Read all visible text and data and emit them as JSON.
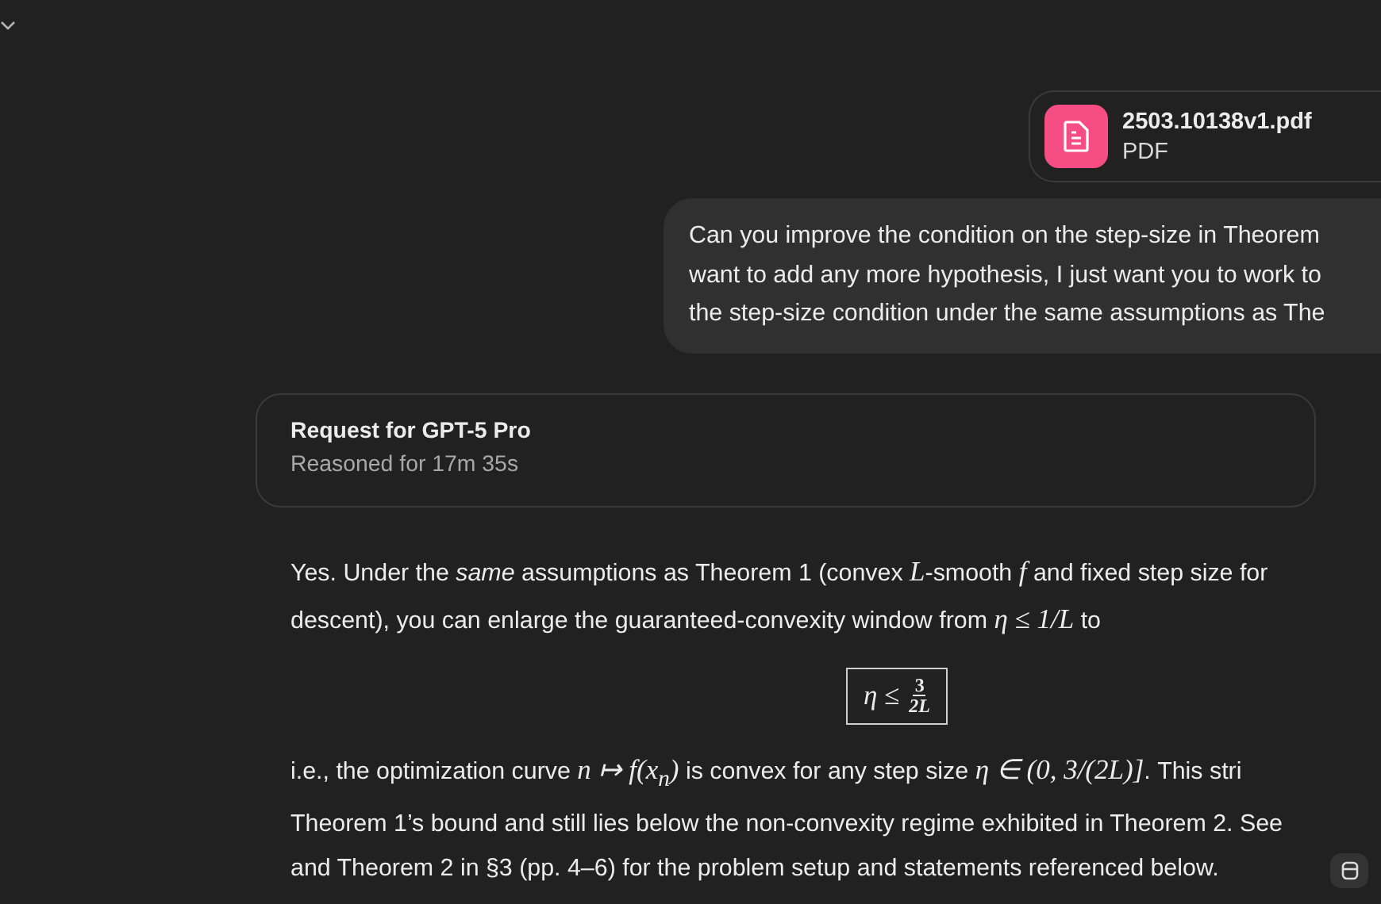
{
  "attachment": {
    "name": "2503.10138v1.pdf",
    "type": "PDF"
  },
  "user_message": {
    "lines": [
      "Can you improve the condition on the step-size in Theorem",
      "want to add any more hypothesis, I just want you to work to",
      "the step-size condition under the same assumptions as The"
    ]
  },
  "reasoning": {
    "title": "Request for GPT-5 Pro",
    "subtitle": "Reasoned for 17m 35s"
  },
  "answer": {
    "intro_lines": [
      [
        {
          "kind": "text",
          "text": "Yes. Under the "
        },
        {
          "kind": "em",
          "text": "same"
        },
        {
          "kind": "text",
          "text": " assumptions as Theorem 1 (convex "
        },
        {
          "kind": "math",
          "text": "L"
        },
        {
          "kind": "text",
          "text": "-smooth "
        },
        {
          "kind": "math",
          "text": "f"
        },
        {
          "kind": "text",
          "text": " and fixed step size for"
        }
      ],
      [
        {
          "kind": "text",
          "text": "descent), you can enlarge the guaranteed-convexity window from "
        },
        {
          "kind": "math",
          "text": "η ≤ 1/L"
        },
        {
          "kind": "text",
          "text": " to"
        }
      ]
    ],
    "boxed_formula": {
      "lhs": "η ≤",
      "numerator": "3",
      "denominator": "2L"
    },
    "body_lines": [
      [
        {
          "kind": "text",
          "text": "i.e., the optimization curve "
        },
        {
          "kind": "math",
          "text": "n ↦ f(x$_{n}$)"
        },
        {
          "kind": "text",
          "text": " is convex for any step size "
        },
        {
          "kind": "math",
          "text": "η ∈ (0, 3/(2L)]"
        },
        {
          "kind": "text",
          "text": ". This stri"
        }
      ],
      [
        {
          "kind": "text",
          "text": "Theorem 1’s bound and still lies below the non-convexity regime exhibited in Theorem 2. See"
        }
      ],
      [
        {
          "kind": "text",
          "text": "and Theorem 2 in §3 (pp. 4–6) for the problem setup and statements referenced below."
        }
      ]
    ]
  }
}
